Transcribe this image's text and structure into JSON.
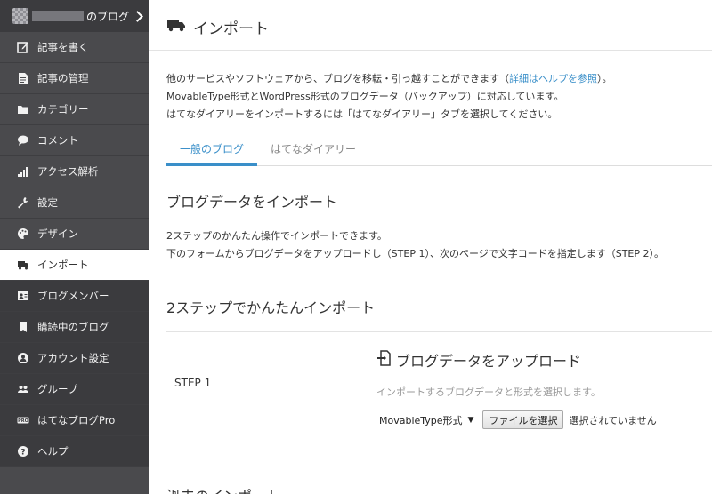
{
  "sidebar": {
    "blog_name": "のブログ",
    "items": [
      {
        "label": "記事を書く",
        "icon": "pencil-square-icon"
      },
      {
        "label": "記事の管理",
        "icon": "document-icon"
      },
      {
        "label": "カテゴリー",
        "icon": "folder-icon"
      },
      {
        "label": "コメント",
        "icon": "speech-bubble-icon"
      },
      {
        "label": "アクセス解析",
        "icon": "signal-bars-icon"
      },
      {
        "label": "設定",
        "icon": "wrench-icon"
      },
      {
        "label": "デザイン",
        "icon": "palette-icon"
      },
      {
        "label": "インポート",
        "icon": "truck-icon"
      },
      {
        "label": "ブログメンバー",
        "icon": "member-card-icon"
      },
      {
        "label": "購読中のブログ",
        "icon": "bookmark-icon"
      },
      {
        "label": "アカウント設定",
        "icon": "user-circle-icon"
      },
      {
        "label": "グループ",
        "icon": "group-icon"
      },
      {
        "label": "はてなブログPro",
        "icon": "pro-badge-icon"
      },
      {
        "label": "ヘルプ",
        "icon": "question-circle-icon"
      }
    ],
    "active_index": 7
  },
  "main": {
    "title": "インポート",
    "intro": {
      "line1_prefix": "他のサービスやソフトウェアから、ブログを移転・引っ越すことができます（",
      "line1_link": "詳細はヘルプを参照",
      "line1_suffix": "）。",
      "line2": "MovableType形式とWordPress形式のブログデータ（バックアップ）に対応しています。",
      "line3": "はてなダイアリーをインポートするには「はてなダイアリー」タブを選択してください。"
    },
    "tabs": [
      {
        "label": "一般のブログ",
        "active": true
      },
      {
        "label": "はてなダイアリー",
        "active": false
      }
    ],
    "section_title": "ブログデータをインポート",
    "desc_line1": "2ステップのかんたん操作でインポートできます。",
    "desc_line2": "下のフォームからブログデータをアップロードし（STEP 1）、次のページで文字コードを指定します（STEP 2）。",
    "steps_title": "2ステップでかんたんインポート",
    "step1": {
      "label": "STEP 1",
      "upload_title": "ブログデータをアップロード",
      "hint": "インポートするブログデータと形式を選択します。",
      "format_selected": "MovableType形式",
      "file_button": "ファイルを選択",
      "file_status": "選択されていません"
    },
    "past_title": "過去のインポート"
  },
  "colors": {
    "sidebar_bg": "#4a4a4d",
    "accent": "#3a8fc9"
  }
}
